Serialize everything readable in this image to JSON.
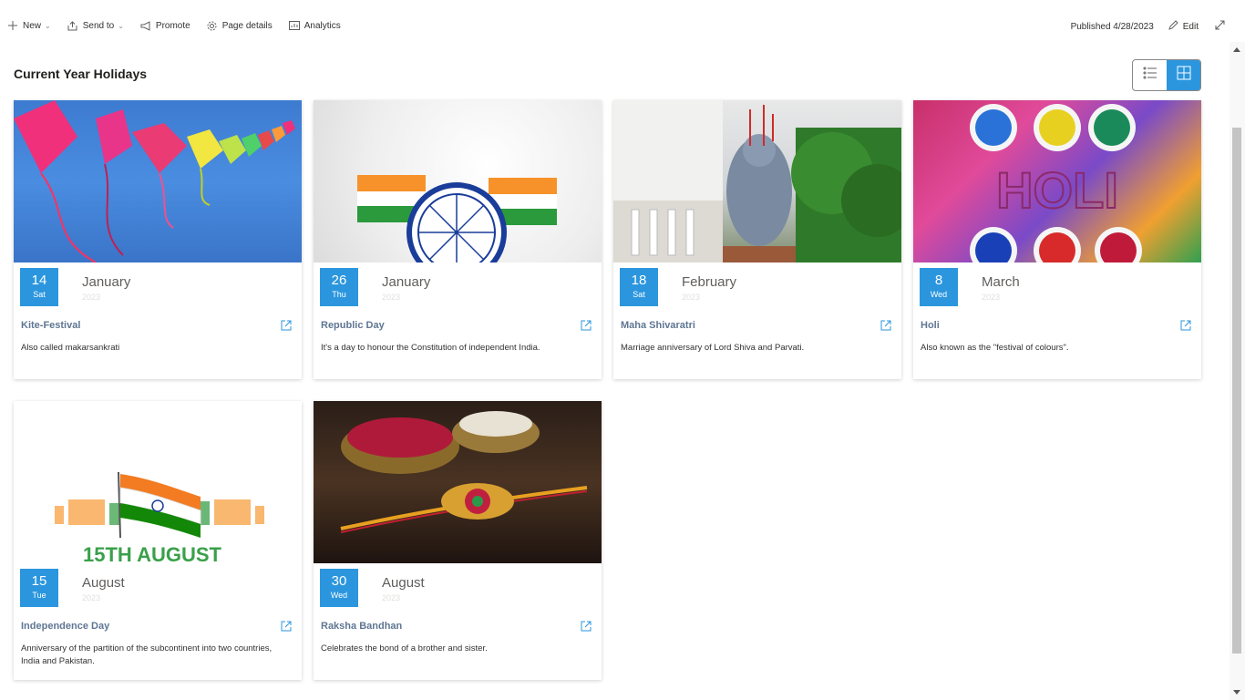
{
  "toolbar": {
    "new_label": "New",
    "send_to_label": "Send to",
    "promote_label": "Promote",
    "page_details_label": "Page details",
    "analytics_label": "Analytics",
    "published_label": "Published 4/28/2023",
    "edit_label": "Edit"
  },
  "section": {
    "title": "Current Year Holidays"
  },
  "accent_color": "#2b96de",
  "cards": [
    {
      "day": "14",
      "weekday": "Sat",
      "month": "January",
      "year": "2023",
      "title": "Kite-Festival",
      "description": "Also called makarsankrati"
    },
    {
      "day": "26",
      "weekday": "Thu",
      "month": "January",
      "year": "2023",
      "title": "Republic Day",
      "description": "It's a day to honour the Constitution of independent India."
    },
    {
      "day": "18",
      "weekday": "Sat",
      "month": "February",
      "year": "2023",
      "title": "Maha Shivaratri",
      "description": "Marriage anniversary of Lord Shiva and Parvati."
    },
    {
      "day": "8",
      "weekday": "Wed",
      "month": "March",
      "year": "2023",
      "title": "Holi",
      "description": "Also known as the \"festival of colours\"."
    },
    {
      "day": "15",
      "weekday": "Tue",
      "month": "August",
      "year": "2023",
      "title": "Independence Day",
      "description": "Anniversary of the partition of the subcontinent into two countries, India and Pakistan."
    },
    {
      "day": "30",
      "weekday": "Wed",
      "month": "August",
      "year": "2023",
      "title": "Raksha Bandhan",
      "description": "Celebrates the bond of a brother and sister."
    }
  ],
  "images": {
    "independence_text": "15TH AUGUST",
    "holi_text": "HOLI"
  }
}
